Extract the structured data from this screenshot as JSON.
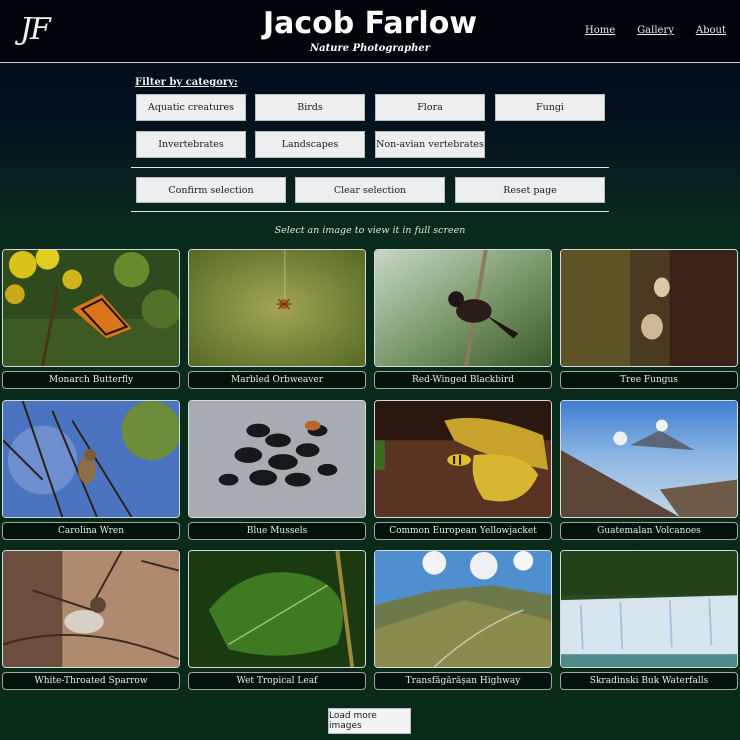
{
  "header": {
    "logo_text": "JF",
    "title": "Jacob Farlow",
    "subtitle": "Nature Photographer",
    "nav": [
      "Home",
      "Gallery",
      "About"
    ]
  },
  "filter": {
    "label": "Filter by category:",
    "categories": [
      "Aquatic creatures",
      "Birds",
      "Flora",
      "Fungi",
      "Invertebrates",
      "Landscapes",
      "Non-avian vertebrates"
    ],
    "actions": [
      "Confirm selection",
      "Clear selection",
      "Reset page"
    ]
  },
  "hint": "Select an image to view it in full screen",
  "gallery": [
    {
      "caption": "Monarch Butterfly",
      "icon": "butterfly-photo"
    },
    {
      "caption": "Marbled Orbweaver",
      "icon": "spider-photo"
    },
    {
      "caption": "Red-Winged Blackbird",
      "icon": "bird-photo"
    },
    {
      "caption": "Tree Fungus",
      "icon": "fungus-photo"
    },
    {
      "caption": "Carolina Wren",
      "icon": "wren-photo"
    },
    {
      "caption": "Blue Mussels",
      "icon": "mussels-photo"
    },
    {
      "caption": "Common European Yellowjacket",
      "icon": "wasp-photo"
    },
    {
      "caption": "Guatemalan Volcanoes",
      "icon": "volcano-photo"
    },
    {
      "caption": "White-Throated Sparrow",
      "icon": "sparrow-photo"
    },
    {
      "caption": "Wet Tropical Leaf",
      "icon": "leaf-photo"
    },
    {
      "caption": "Transfăgărășan Highway",
      "icon": "highway-photo"
    },
    {
      "caption": "Skradinski Buk Waterfalls",
      "icon": "waterfall-photo"
    }
  ],
  "load_more_label": "Load more images"
}
